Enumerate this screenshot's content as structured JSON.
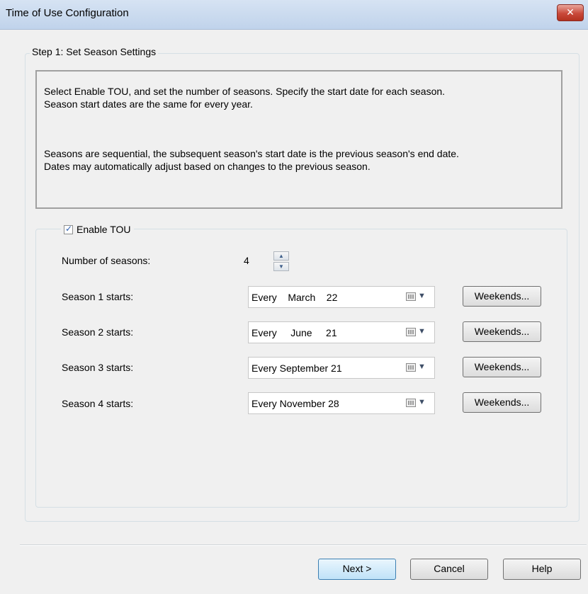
{
  "window": {
    "title": "Time of Use Configuration",
    "close_glyph": "✕"
  },
  "step": {
    "legend": "Step 1: Set Season Settings"
  },
  "info": {
    "line1": "Select Enable TOU, and set the number of seasons.  Specify the start date for each season.",
    "line2": "Season start dates are the same for every year.",
    "line3": "Seasons are sequential, the subsequent season's start date is the previous season's end date.",
    "line4": "Dates may automatically adjust based on changes to the previous season."
  },
  "enable_tou": {
    "label": "Enable TOU",
    "checked": true,
    "check_glyph": "✓"
  },
  "num_seasons": {
    "label": "Number of seasons:",
    "value": "4",
    "up": "▲",
    "down": "▼"
  },
  "seasons": [
    {
      "label": "Season 1 starts:",
      "value": "Every    March    22",
      "button": "Weekends..."
    },
    {
      "label": "Season 2 starts:",
      "value": "Every     June     21",
      "button": "Weekends..."
    },
    {
      "label": "Season 3 starts:",
      "value": "Every September 21",
      "button": "Weekends..."
    },
    {
      "label": "Season 4 starts:",
      "value": "Every November 28",
      "button": "Weekends..."
    }
  ],
  "date_dropdown_glyph": "▼",
  "footer": {
    "next": "Next >",
    "cancel": "Cancel",
    "help": "Help"
  },
  "colors": {
    "titlebar": "#c9daf0",
    "close_button": "#c9493a",
    "default_button_border": "#3c7fb1"
  }
}
